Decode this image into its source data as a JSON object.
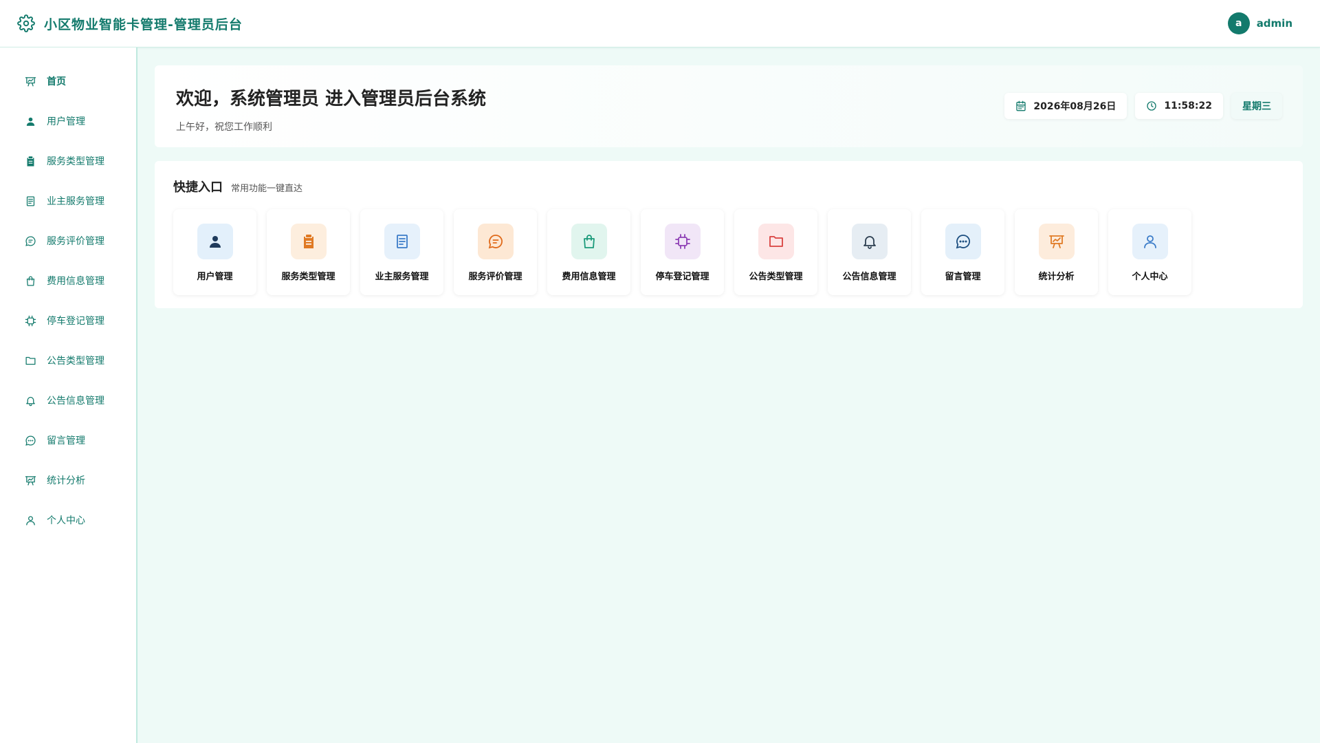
{
  "header": {
    "app_title": "小区物业智能卡管理-管理员后台",
    "logo_icon": "gear-icon",
    "user_initial": "a",
    "user_name": "admin"
  },
  "sidebar": {
    "items": [
      {
        "label": "首页",
        "icon": "presentation-icon",
        "active": true
      },
      {
        "label": "用户管理",
        "icon": "user-icon"
      },
      {
        "label": "服务类型管理",
        "icon": "clipboard-icon"
      },
      {
        "label": "业主服务管理",
        "icon": "document-icon"
      },
      {
        "label": "服务评价管理",
        "icon": "comment-icon"
      },
      {
        "label": "费用信息管理",
        "icon": "shopping-bag-icon"
      },
      {
        "label": "停车登记管理",
        "icon": "chip-icon"
      },
      {
        "label": "公告类型管理",
        "icon": "folder-icon"
      },
      {
        "label": "公告信息管理",
        "icon": "bell-icon"
      },
      {
        "label": "留言管理",
        "icon": "chat-icon"
      },
      {
        "label": "统计分析",
        "icon": "presentation-icon"
      },
      {
        "label": "个人中心",
        "icon": "user-outline-icon"
      }
    ]
  },
  "welcome": {
    "title": "欢迎，系统管理员 进入管理员后台系统",
    "subtitle": "上午好，祝您工作顺利",
    "date": "2026年08月26日",
    "time": "11:58:22",
    "weekday": "星期三"
  },
  "quick": {
    "title": "快捷入口",
    "subtitle": "常用功能一键直达",
    "tiles": [
      {
        "label": "用户管理",
        "icon": "user-icon",
        "bg": "#e3f0fb",
        "color": "#1f3b5c"
      },
      {
        "label": "服务类型管理",
        "icon": "clipboard-icon",
        "bg": "#fdeede",
        "color": "#e07a24"
      },
      {
        "label": "业主服务管理",
        "icon": "document-icon",
        "bg": "#e6f1fb",
        "color": "#3a7bc8"
      },
      {
        "label": "服务评价管理",
        "icon": "comment-icon",
        "bg": "#fde8d4",
        "color": "#e06a1a"
      },
      {
        "label": "费用信息管理",
        "icon": "shopping-bag-icon",
        "bg": "#e1f5ee",
        "color": "#1b9a7a"
      },
      {
        "label": "停车登记管理",
        "icon": "chip-icon",
        "bg": "#f1e6f7",
        "color": "#8e3fb5"
      },
      {
        "label": "公告类型管理",
        "icon": "folder-icon",
        "bg": "#fde6e6",
        "color": "#d9413f"
      },
      {
        "label": "公告信息管理",
        "icon": "bell-icon",
        "bg": "#e6edf3",
        "color": "#2c3e50"
      },
      {
        "label": "留言管理",
        "icon": "chat-icon",
        "bg": "#e4f0fa",
        "color": "#1d4f80"
      },
      {
        "label": "统计分析",
        "icon": "presentation-icon",
        "bg": "#fdecdc",
        "color": "#e07a24"
      },
      {
        "label": "个人中心",
        "icon": "user-outline-icon",
        "bg": "#e6f1fb",
        "color": "#3a7bc8"
      }
    ]
  },
  "colors": {
    "brand": "#137a6c",
    "background": "#eefaf7",
    "sidebar_border": "#bfe9df"
  }
}
